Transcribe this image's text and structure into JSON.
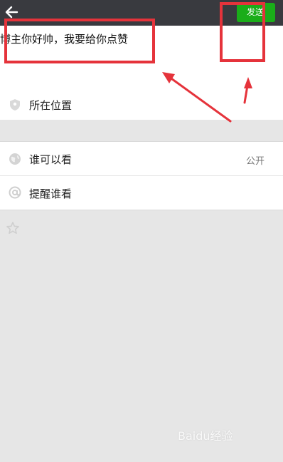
{
  "header": {
    "back_icon": "arrow-left-icon",
    "send_label": "发送"
  },
  "compose": {
    "text": "博主你好帅，我要给你点赞"
  },
  "location": {
    "icon": "location-pin-icon",
    "label": "所在位置"
  },
  "visibility": {
    "icon": "visibility-globe-icon",
    "label": "谁可以看",
    "value": "公开"
  },
  "mention": {
    "icon": "at-sign-icon",
    "label": "提醒谁看"
  },
  "colors": {
    "topbar": "#393a3f",
    "send_button": "#1aad19",
    "annotation_red": "#e5333b",
    "background": "#e6e6e6"
  },
  "watermark": {
    "text": "Baidu经验"
  }
}
